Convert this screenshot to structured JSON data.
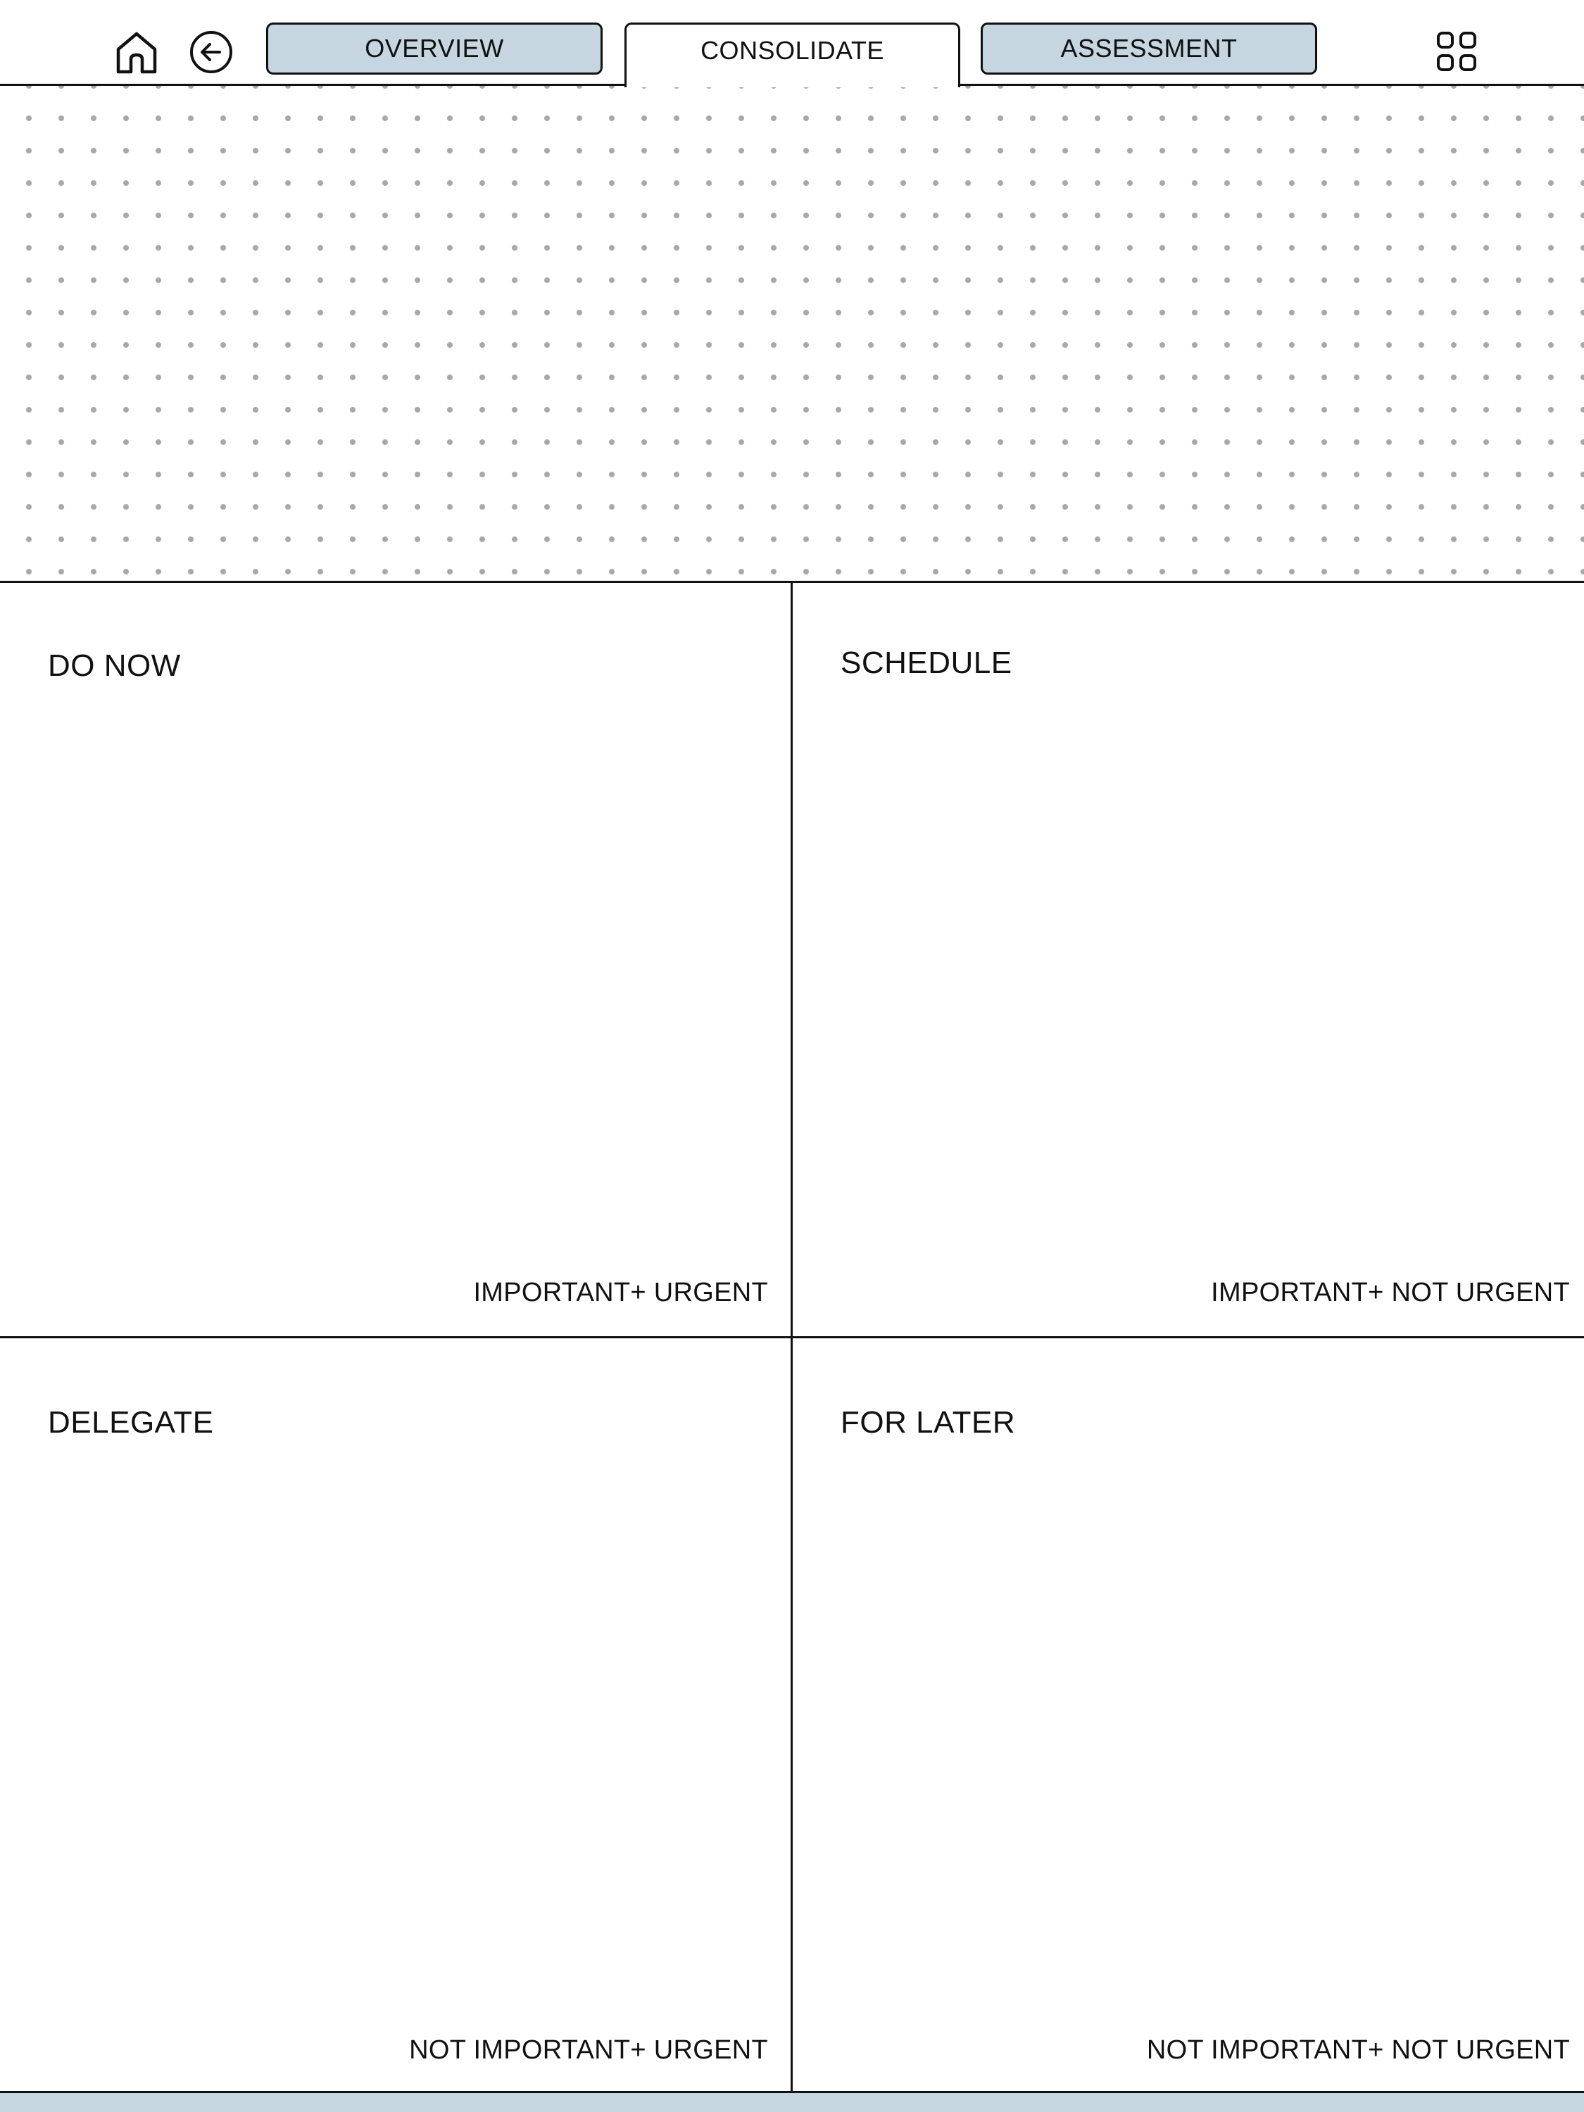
{
  "nav": {
    "tabs": [
      {
        "label": "OVERVIEW",
        "state": "inactive"
      },
      {
        "label": "CONSOLIDATE",
        "state": "active"
      },
      {
        "label": "ASSESSMENT",
        "state": "inactive"
      }
    ],
    "icons": {
      "home": "home-icon",
      "back": "back-arrow-icon",
      "grid": "grid-menu-icon"
    }
  },
  "colors": {
    "tab_inactive_bg": "#c5d6e0",
    "ink": "#111111",
    "dot": "#a8a8a8",
    "bottom_strip": "#c5d6e0"
  },
  "matrix": {
    "quadrants": [
      {
        "title": "DO NOW",
        "criteria": "IMPORTANT+ URGENT"
      },
      {
        "title": "SCHEDULE",
        "criteria": "IMPORTANT+ NOT URGENT"
      },
      {
        "title": "DELEGATE",
        "criteria": "NOT IMPORTANT+ URGENT"
      },
      {
        "title": "FOR LATER",
        "criteria": "NOT IMPORTANT+ NOT URGENT"
      }
    ]
  }
}
